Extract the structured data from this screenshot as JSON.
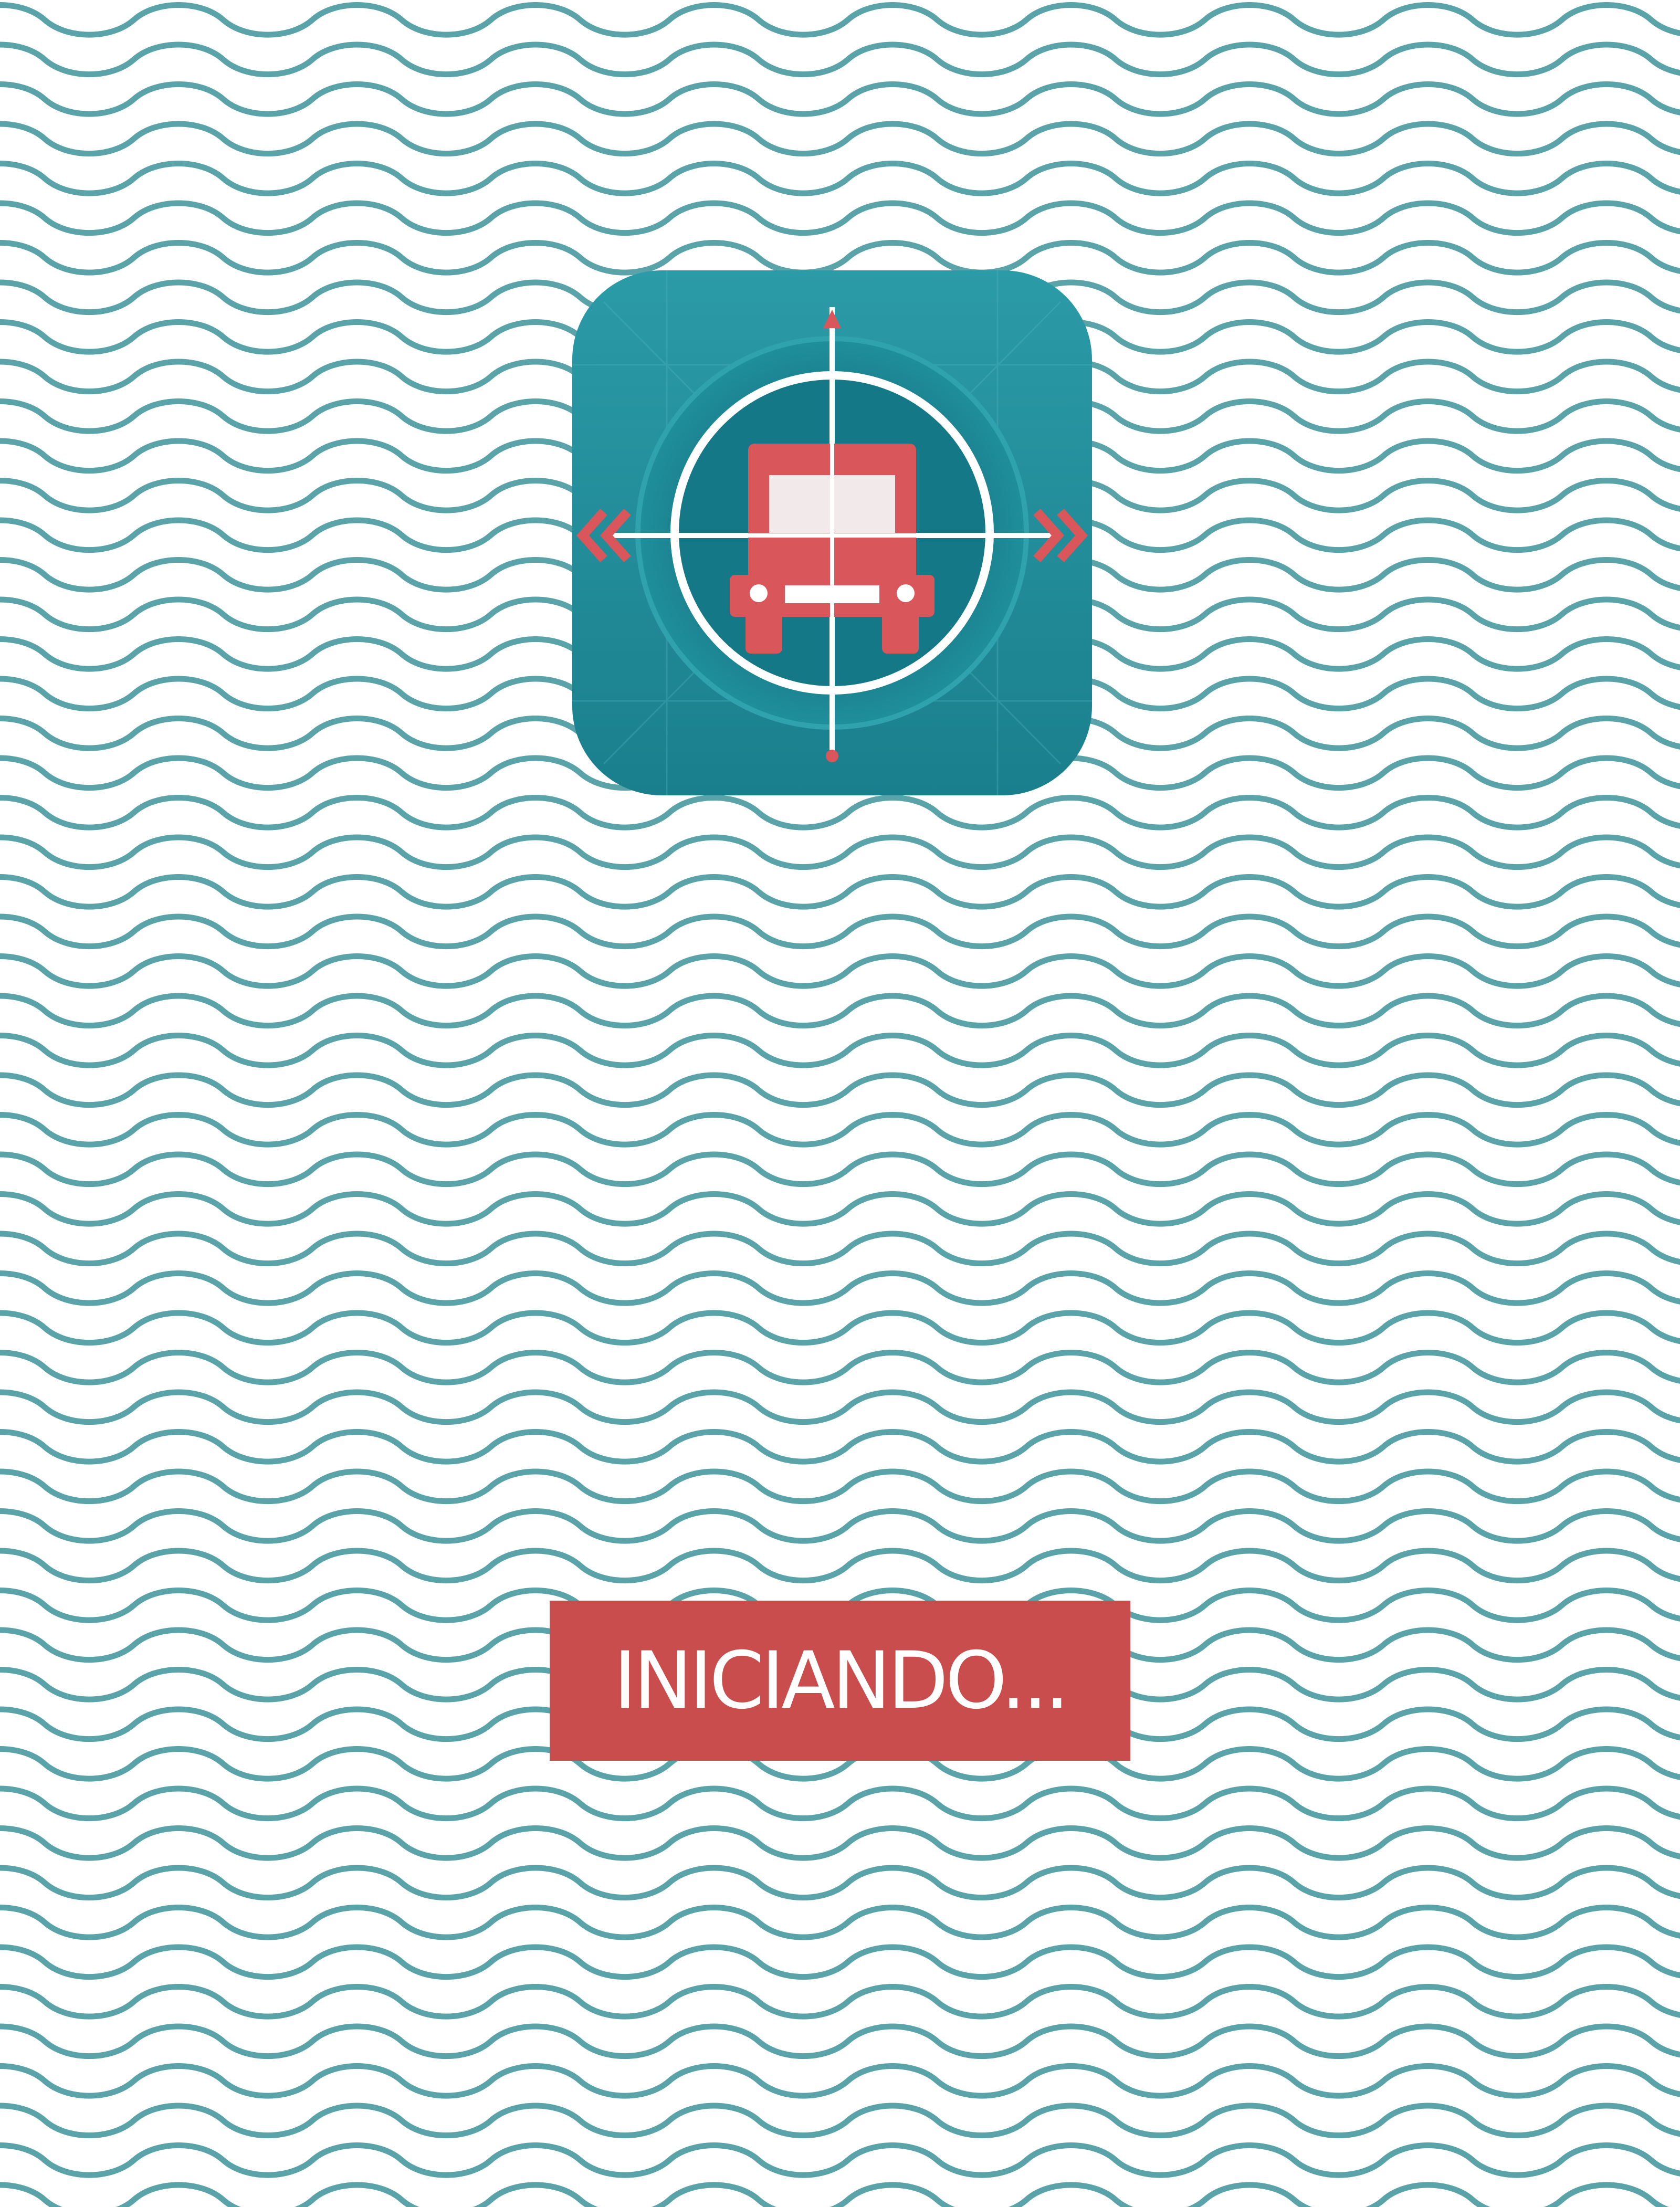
{
  "app": {
    "icon": "ambulance-crosshair-icon"
  },
  "status": {
    "text": "INICIANDO..."
  },
  "colors": {
    "wave": "#5aa3a9",
    "background": "#ffffff",
    "icon_teal": "#1f8a96",
    "icon_red": "#d9575a",
    "status_box": "#c84d4c",
    "status_text": "#ffffff"
  }
}
